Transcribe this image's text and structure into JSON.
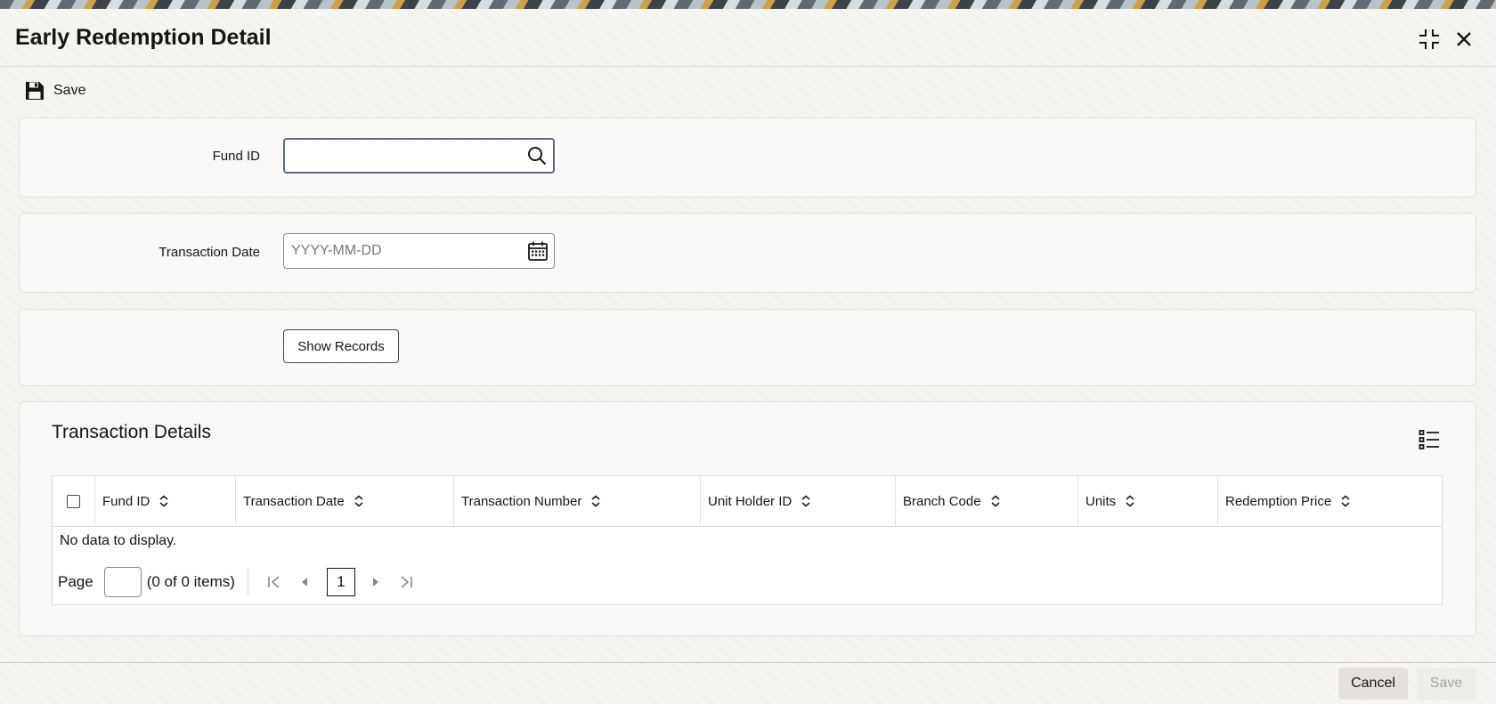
{
  "window": {
    "title": "Early Redemption Detail"
  },
  "toolbar": {
    "save_label": "Save"
  },
  "form": {
    "fund_id": {
      "label": "Fund ID",
      "value": "",
      "placeholder": ""
    },
    "transaction_date": {
      "label": "Transaction Date",
      "value": "",
      "placeholder": "YYYY-MM-DD"
    },
    "show_records_label": "Show Records"
  },
  "transaction_details": {
    "title": "Transaction Details",
    "columns": [
      "Fund ID",
      "Transaction Date",
      "Transaction Number",
      "Unit Holder ID",
      "Branch Code",
      "Units",
      "Redemption Price"
    ],
    "rows": [],
    "empty_message": "No data to display.",
    "pager": {
      "page_label": "Page",
      "page_value": "",
      "items_text": "(0 of 0 items)",
      "current_page": "1"
    }
  },
  "footer": {
    "cancel_label": "Cancel",
    "save_label": "Save"
  },
  "colors": {
    "accent_border": "#5c6a80",
    "text": "#161513",
    "disabled_text": "#a8a5a0"
  },
  "icons": {
    "restore": "collapse-icon",
    "close": "close-icon",
    "save": "floppy-disk-icon",
    "search": "search-icon",
    "calendar": "calendar-icon",
    "columns": "column-list-icon",
    "sort": "sort-icon"
  }
}
